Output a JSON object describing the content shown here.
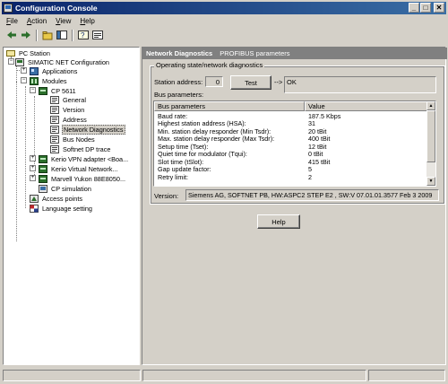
{
  "window": {
    "title": "Configuration Console"
  },
  "menu": [
    {
      "label": "File",
      "key": "F",
      "rest": "ile"
    },
    {
      "label": "Action",
      "key": "A",
      "rest": "ction"
    },
    {
      "label": "View",
      "key": "V",
      "rest": "iew"
    },
    {
      "label": "Help",
      "key": "H",
      "rest": "elp"
    }
  ],
  "tree": {
    "root": "PC Station",
    "items": [
      {
        "label": "SIMATIC NET Configuration"
      },
      {
        "label": "Applications"
      },
      {
        "label": "Modules"
      },
      {
        "label": "CP 5611"
      },
      {
        "label": "General"
      },
      {
        "label": "Version"
      },
      {
        "label": "Address"
      },
      {
        "label": "Network Diagnostics"
      },
      {
        "label": "Bus Nodes"
      },
      {
        "label": "Softnet DP trace"
      },
      {
        "label": "Kerio VPN adapter <Boa..."
      },
      {
        "label": "Kerio Virtual Network..."
      },
      {
        "label": "Marvell Yukon 88E8050..."
      },
      {
        "label": "CP simulation"
      },
      {
        "label": "Access points"
      },
      {
        "label": "Language setting"
      }
    ]
  },
  "pane": {
    "header_title": "Network Diagnostics",
    "header_sub": "PROFIBUS parameters",
    "group_label": "Operating state/network diagnostics",
    "station_address_label": "Station address:",
    "station_address_value": "0",
    "test_button": "Test",
    "arrow_text": "-->",
    "result_value": "OK",
    "bus_params_label": "Bus parameters:",
    "list": {
      "headers": [
        "Bus parameters",
        "Value"
      ],
      "rows": [
        [
          "Baud rate:",
          "187.5 Kbps"
        ],
        [
          "Highest station address (HSA):",
          "31"
        ],
        [
          "Min. station delay responder (Min Tsdr):",
          "20 tBit"
        ],
        [
          "Max. station delay responder (Max Tsdr):",
          "400 tBit"
        ],
        [
          "Setup time (Tset):",
          "12 tBit"
        ],
        [
          "Quiet time for modulator (Tqui):",
          "0 tBit"
        ],
        [
          "Slot time (tSlot):",
          "415 tBit"
        ],
        [
          "Gap update factor:",
          "5"
        ],
        [
          "Retry limit:",
          "2"
        ]
      ]
    },
    "version_label": "Version:",
    "version_value": "Siemens AG, SOFTNET PB, HW:ASPC2 STEP E2 , SW:V 07.01.01.3577 Feb  3 2009",
    "help_button": "Help"
  },
  "colors": {
    "titlebar": "#0a246a",
    "face": "#d4d0c8",
    "pane_header": "#808080"
  }
}
